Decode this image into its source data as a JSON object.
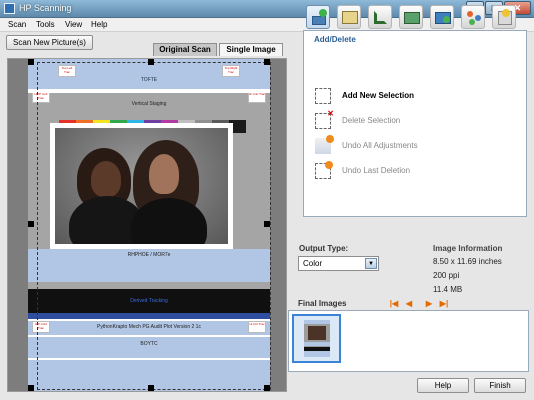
{
  "window": {
    "title": "HP Scanning"
  },
  "titlebar_buttons": {
    "minimize": "–",
    "maximize": "□",
    "close": "✕"
  },
  "menu": [
    "Scan",
    "Tools",
    "View",
    "Help"
  ],
  "scan_button": "Scan New Picture(s)",
  "tabs": {
    "original": "Original Scan",
    "single": "Single Image"
  },
  "target_labels": {
    "top": "TOFTE",
    "vertical": "Vertical Staging",
    "photo": "RHPHOE / MOR7e",
    "overlap": "Derived Tracking",
    "bottom_text": "PythonKrapto Mech PG Audit Plot Version 2 1c",
    "bottom": "BOYTC",
    "corner_left": "Top Left Trac",
    "corner_right": "Top Right Trac",
    "corner_mid_left": "HiPP Cntr Trac",
    "corner_mid_right": "Hi Cntr Trac",
    "bottom_left": "HiP Cntrl Trac",
    "bottom_right": "Hi Ctrl Trac"
  },
  "color_swatches": [
    "#e53228",
    "#f06f25",
    "#f6e322",
    "#2fa94b",
    "#2fb6e6",
    "#6e3fa0",
    "#b23aa0",
    "#bfbfbf",
    "#8f8f8f",
    "#5a5a5a",
    "#1b1b1b"
  ],
  "toolbar_icons": [
    "add-delete-icon",
    "resize-icon",
    "crop-icon",
    "edit-icon",
    "adjust-icon",
    "preferences-icon",
    "special-icon"
  ],
  "panel": {
    "title": "Add/Delete",
    "actions": [
      {
        "label": "Add New Selection",
        "enabled": true
      },
      {
        "label": "Delete Selection",
        "enabled": false
      },
      {
        "label": "Undo All Adjustments",
        "enabled": false
      },
      {
        "label": "Undo Last Deletion",
        "enabled": false
      }
    ]
  },
  "output_type": {
    "label": "Output Type:",
    "value": "Color"
  },
  "image_info": {
    "label": "Image Information",
    "size": "8.50 x 11.69 inches",
    "resolution": "200 ppi",
    "file_size": "11.4 MB"
  },
  "final_images": {
    "label": "Final Images",
    "nav": [
      "|◀",
      "◀",
      "▶",
      "▶|"
    ]
  },
  "footer": {
    "help": "Help",
    "finish": "Finish"
  }
}
